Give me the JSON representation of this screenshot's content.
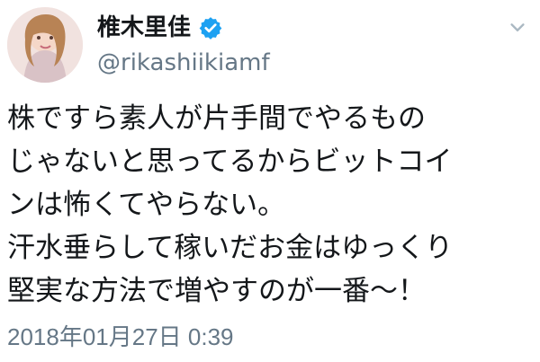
{
  "profile": {
    "display_name": "椎木里佳",
    "handle": "@rikashiikiamf",
    "avatar_icon": "user-avatar",
    "verified_icon": "verified-badge-icon",
    "verified_color": "#1da1f2"
  },
  "tweet": {
    "lines": [
      "株ですら素人が片手間でやるもの",
      "じゃないと思ってるからビットコイ",
      "ンは怖くてやらない。",
      "汗水垂らして稼いだお金はゆっくり",
      "堅実な方法で増やすのが一番～！"
    ],
    "timestamp": "2018年01月27日 0:39"
  },
  "menu_icon": "chevron-down-icon",
  "colors": {
    "text": "#14171a",
    "secondary": "#657786",
    "background": "#ffffff"
  }
}
